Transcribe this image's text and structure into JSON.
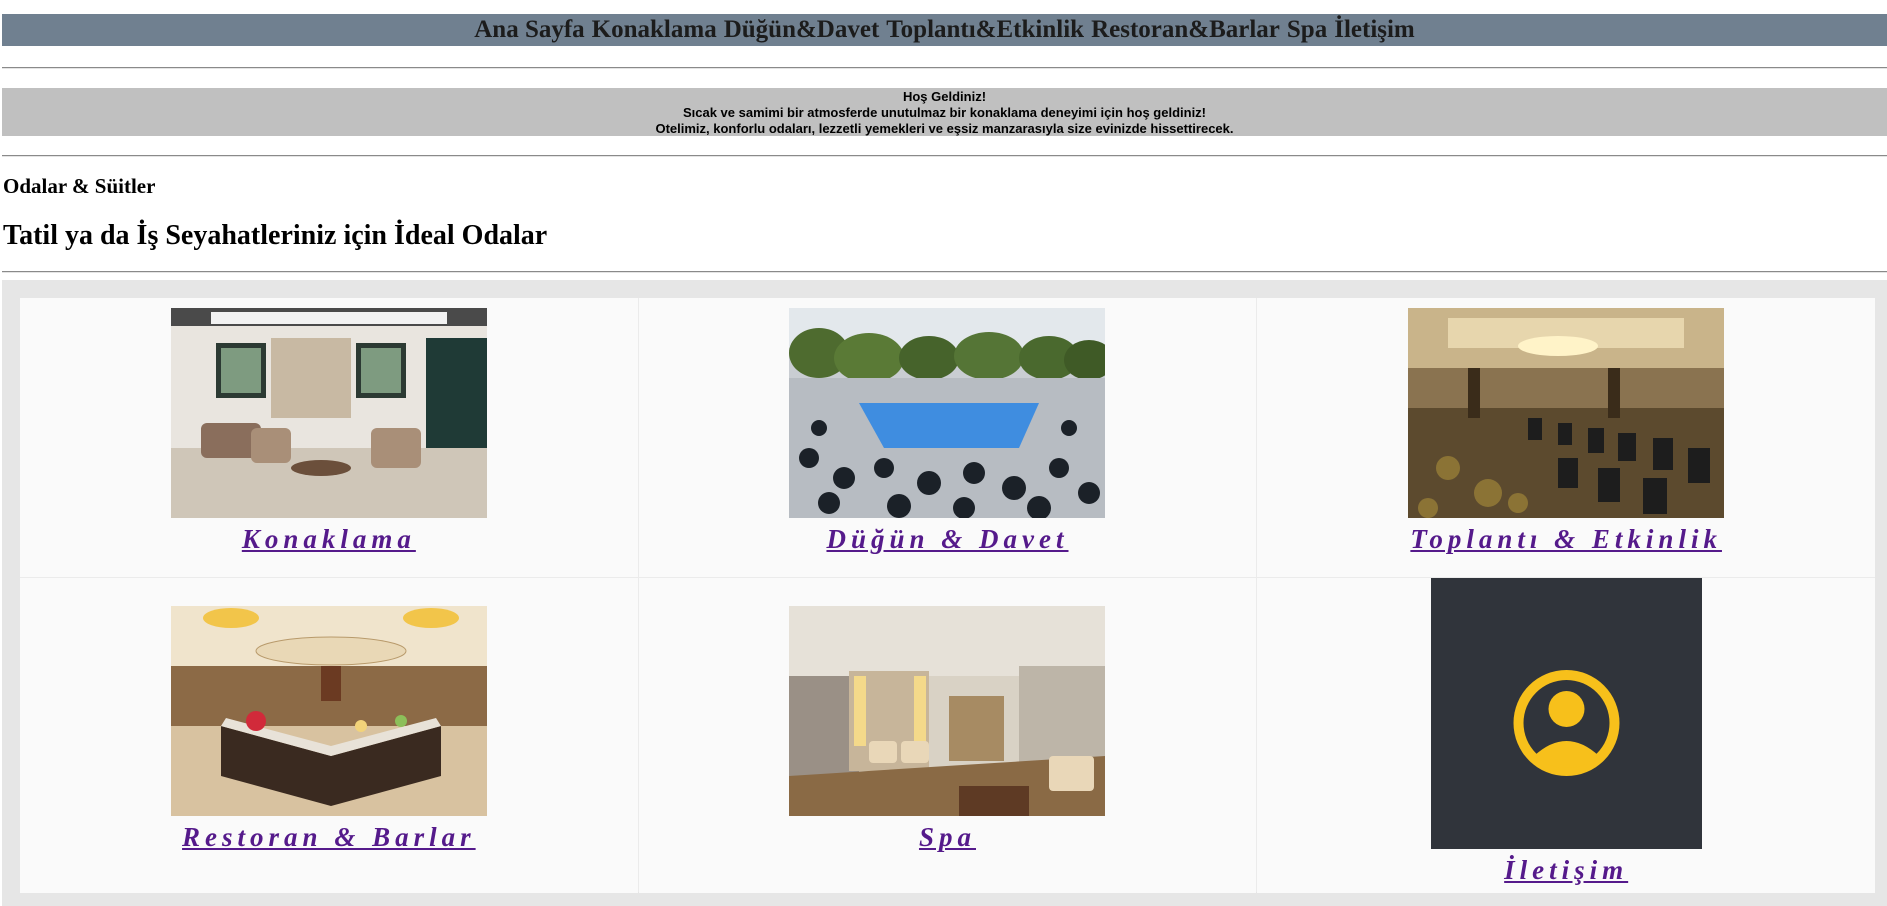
{
  "nav": {
    "items": [
      "Ana Sayfa",
      "Konaklama",
      "Düğün&Davet",
      "Toplantı&Etkinlik",
      "Restoran&Barlar",
      "Spa",
      "İletişim"
    ]
  },
  "welcome": {
    "line1": "Hoş Geldiniz!",
    "line2": "Sıcak ve samimi bir atmosferde unutulmaz bir konaklama deneyimi için hoş geldiniz!",
    "line3": "Otelimiz, konforlu odaları, lezzetli yemekleri ve eşsiz manzarasıyla size evinizde hissettirecek."
  },
  "section": {
    "subtitle": "Odalar & Süitler",
    "title": "Tatil ya da İş Seyahatleriniz için İdeal Odalar"
  },
  "cards": [
    {
      "label": "Konaklama",
      "image": "lounge-photo"
    },
    {
      "label": "Düğün & Davet",
      "image": "poolside-event-photo"
    },
    {
      "label": "Toplantı & Etkinlik",
      "image": "meeting-hall-photo"
    },
    {
      "label": "Restoran & Barlar",
      "image": "restaurant-photo"
    },
    {
      "label": "Spa",
      "image": "spa-photo"
    },
    {
      "label": "İletişim",
      "image": "user-avatar-icon"
    }
  ],
  "colors": {
    "nav_bg": "#708090",
    "welcome_bg": "#c0c0c0",
    "link": "#551a8b",
    "avatar_bg": "#30343b",
    "avatar_fg": "#f7c01b"
  }
}
